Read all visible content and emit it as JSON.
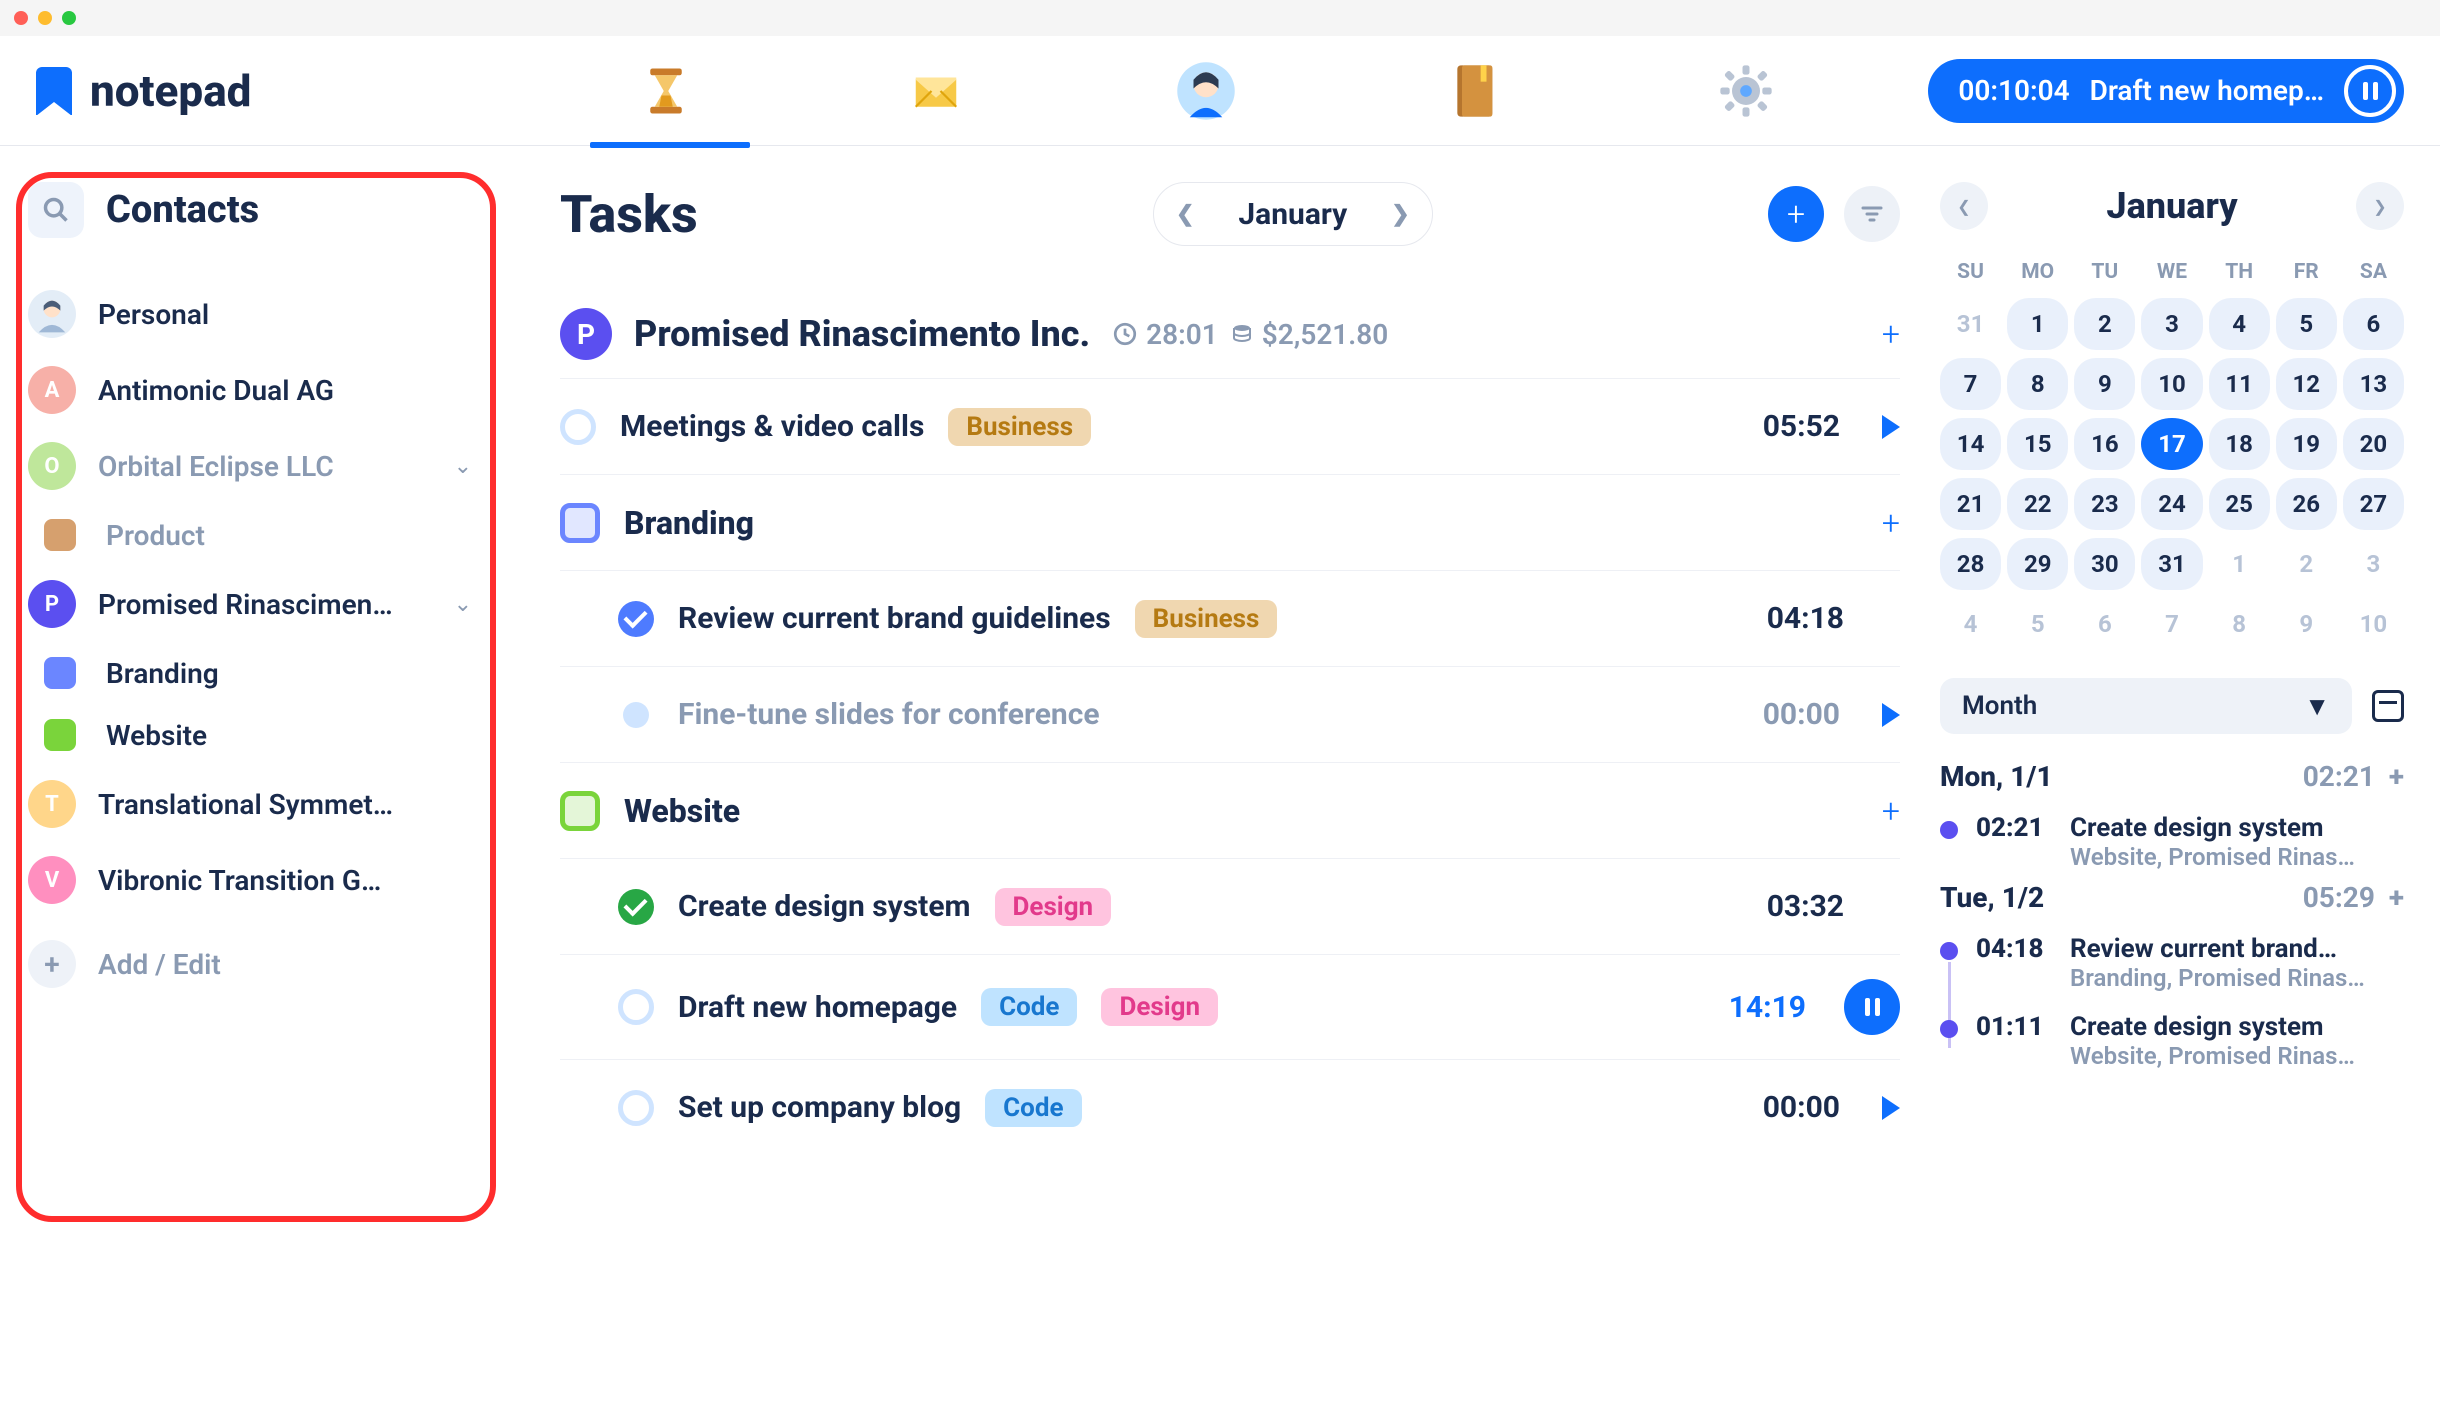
{
  "app": {
    "name": "notepad"
  },
  "timer": {
    "elapsed": "00:10:04",
    "task": "Draft new homep…"
  },
  "sidebar": {
    "title": "Contacts",
    "items": [
      {
        "label": "Personal",
        "avatar_type": "face"
      },
      {
        "label": "Antimonic Dual AG",
        "avatar_letter": "A",
        "avatar_color": "#f7b0a8"
      },
      {
        "label": "Orbital Eclipse LLC",
        "avatar_letter": "O",
        "avatar_color": "#bfe79b",
        "expanded": true,
        "subs": [
          {
            "label": "Product",
            "color": "#d6a06e"
          }
        ]
      },
      {
        "label": "Promised Rinascimen…",
        "avatar_letter": "P",
        "avatar_color": "#5b4ff0",
        "expanded": true,
        "subs": [
          {
            "label": "Branding",
            "color": "#6b86ff"
          },
          {
            "label": "Website",
            "color": "#7ad43b"
          }
        ]
      },
      {
        "label": "Translational Symmet…",
        "avatar_letter": "T",
        "avatar_color": "#ffd68a"
      },
      {
        "label": "Vibronic Transition G…",
        "avatar_letter": "V",
        "avatar_color": "#ff8fbf"
      }
    ],
    "add_label": "Add / Edit"
  },
  "main": {
    "title": "Tasks",
    "month": "January",
    "company": {
      "name": "Promised Rinascimento Inc.",
      "time": "28:01",
      "amount": "$2,521.80"
    },
    "rows": [
      {
        "kind": "task",
        "title": "Meetings & video calls",
        "tag": "Business",
        "tag_bg": "#f0d7b0",
        "tag_fg": "#b57a12",
        "time": "05:52",
        "action": "play"
      },
      {
        "kind": "section",
        "title": "Branding",
        "box_color": "#6b86ff",
        "action": "add"
      },
      {
        "kind": "task-indent",
        "title": "Review current brand guidelines",
        "check": "blue",
        "tag": "Business",
        "tag_bg": "#f0d7b0",
        "tag_fg": "#b57a12",
        "time": "04:18"
      },
      {
        "kind": "task-indent-muted",
        "title": "Fine-tune slides for conference",
        "dot_color": "#cfe4ff",
        "time": "00:00",
        "action": "play"
      },
      {
        "kind": "section",
        "title": "Website",
        "box_color": "#7ad43b",
        "action": "add"
      },
      {
        "kind": "task-indent",
        "title": "Create design system",
        "check": "green",
        "tag": "Design",
        "tag_bg": "#ffc4df",
        "tag_fg": "#e23a8b",
        "time": "03:32"
      },
      {
        "kind": "task-indent",
        "title": "Draft new homepage",
        "ring": "blue",
        "tags": [
          {
            "text": "Code",
            "bg": "#bfe3ff",
            "fg": "#1877cf"
          },
          {
            "text": "Design",
            "bg": "#ffc4df",
            "fg": "#e23a8b"
          }
        ],
        "time": "14:19",
        "time_color": "blue",
        "action": "pause"
      },
      {
        "kind": "task-indent",
        "title": "Set up company blog",
        "ring": "blue",
        "tag": "Code",
        "tag_bg": "#bfe3ff",
        "tag_fg": "#1877cf",
        "time": "00:00",
        "action": "play"
      }
    ]
  },
  "calendar": {
    "title": "January",
    "dow": [
      "SU",
      "MO",
      "TU",
      "WE",
      "TH",
      "FR",
      "SA"
    ],
    "cells": [
      {
        "n": "31",
        "cls": "out"
      },
      {
        "n": "1",
        "cls": "inrange"
      },
      {
        "n": "2",
        "cls": "inrange"
      },
      {
        "n": "3",
        "cls": "inrange"
      },
      {
        "n": "4",
        "cls": "inrange"
      },
      {
        "n": "5",
        "cls": "inrange"
      },
      {
        "n": "6",
        "cls": "inrange"
      },
      {
        "n": "7",
        "cls": "inrange"
      },
      {
        "n": "8",
        "cls": "inrange"
      },
      {
        "n": "9",
        "cls": "inrange"
      },
      {
        "n": "10",
        "cls": "inrange"
      },
      {
        "n": "11",
        "cls": "inrange"
      },
      {
        "n": "12",
        "cls": "inrange"
      },
      {
        "n": "13",
        "cls": "inrange"
      },
      {
        "n": "14",
        "cls": "inrange"
      },
      {
        "n": "15",
        "cls": "inrange"
      },
      {
        "n": "16",
        "cls": "inrange"
      },
      {
        "n": "17",
        "cls": "sel"
      },
      {
        "n": "18",
        "cls": "inrange"
      },
      {
        "n": "19",
        "cls": "inrange"
      },
      {
        "n": "20",
        "cls": "inrange"
      },
      {
        "n": "21",
        "cls": "inrange"
      },
      {
        "n": "22",
        "cls": "inrange"
      },
      {
        "n": "23",
        "cls": "inrange"
      },
      {
        "n": "24",
        "cls": "inrange"
      },
      {
        "n": "25",
        "cls": "inrange"
      },
      {
        "n": "26",
        "cls": "inrange"
      },
      {
        "n": "27",
        "cls": "inrange"
      },
      {
        "n": "28",
        "cls": "inrange"
      },
      {
        "n": "29",
        "cls": "inrange"
      },
      {
        "n": "30",
        "cls": "inrange"
      },
      {
        "n": "31",
        "cls": "inrange"
      },
      {
        "n": "1",
        "cls": "out"
      },
      {
        "n": "2",
        "cls": "out"
      },
      {
        "n": "3",
        "cls": "out"
      },
      {
        "n": "4",
        "cls": "out"
      },
      {
        "n": "5",
        "cls": "out"
      },
      {
        "n": "6",
        "cls": "out"
      },
      {
        "n": "7",
        "cls": "out"
      },
      {
        "n": "8",
        "cls": "out"
      },
      {
        "n": "9",
        "cls": "out"
      },
      {
        "n": "10",
        "cls": "out"
      }
    ],
    "range_label": "Month"
  },
  "timesheet": [
    {
      "day": "Mon, 1/1",
      "total": "02:21",
      "entries": [
        {
          "time": "02:21",
          "title": "Create design system",
          "sub": "Website, Promised Rinas…",
          "color": "#5b4ff0"
        }
      ]
    },
    {
      "day": "Tue, 1/2",
      "total": "05:29",
      "entries": [
        {
          "time": "04:18",
          "title": "Review current brand…",
          "sub": "Branding, Promised Rinas…",
          "color": "#5b4ff0",
          "connect": true
        },
        {
          "time": "01:11",
          "title": "Create design system",
          "sub": "Website, Promised Rinas…",
          "color": "#5b4ff0"
        }
      ]
    }
  ]
}
